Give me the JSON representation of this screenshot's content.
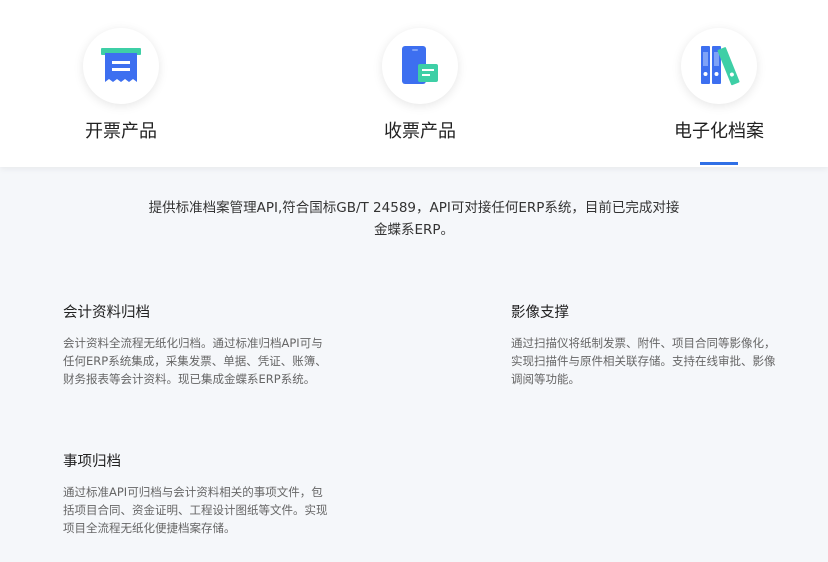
{
  "tabs": [
    {
      "label": "开票产品",
      "icon": "invoice-receipt-icon"
    },
    {
      "label": "收票产品",
      "icon": "phone-receipt-icon"
    },
    {
      "label": "电子化档案",
      "icon": "archive-binders-icon"
    }
  ],
  "active_tab": 2,
  "colors": {
    "accent": "#2f6fe6",
    "green": "#3ecfa6",
    "blue": "#3d6ff0"
  },
  "intro": {
    "line1": "提供标准档案管理API,符合国标GB/T 24589，API可对接任何ERP系统，目前已完成对接",
    "line2": "金蝶系ERP。"
  },
  "features": [
    {
      "title": "会计资料归档",
      "desc": "会计资料全流程无纸化归档。通过标准归档API可与任何ERP系统集成，采集发票、单据、凭证、账簿、财务报表等会计资料。现已集成金蝶系ERP系统。"
    },
    {
      "title": "影像支撑",
      "desc": "通过扫描仪将纸制发票、附件、项目合同等影像化，实现扫描件与原件相关联存储。支持在线审批、影像调阅等功能。"
    },
    {
      "title": "事项归档",
      "desc": "通过标准API可归档与会计资料相关的事项文件，包括项目合同、资金证明、工程设计图纸等文件。实现项目全流程无纸化便捷档案存储。"
    }
  ]
}
